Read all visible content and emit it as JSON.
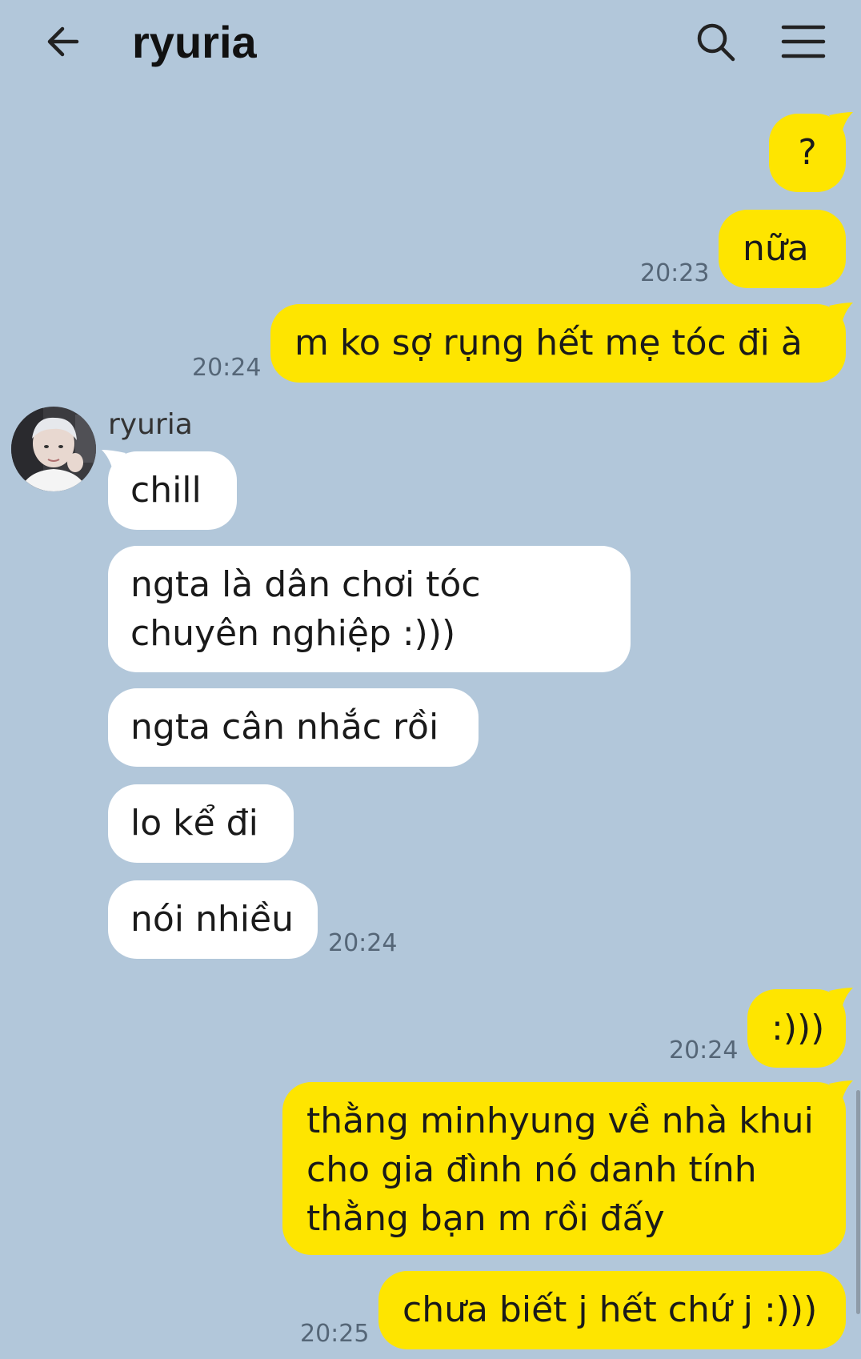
{
  "header": {
    "title": "ryuria",
    "back_icon": "arrow-left-icon",
    "search_icon": "search-icon",
    "menu_icon": "hamburger-menu-icon"
  },
  "colors": {
    "background": "#b2c7da",
    "my_bubble": "#fee500",
    "their_bubble": "#ffffff",
    "time_text": "#556677"
  },
  "messages": {
    "m1": "?",
    "m2": "nữa",
    "m2_time": "20:23",
    "m3": "m ko sợ rụng hết mẹ tóc đi à",
    "m3_time": "20:24",
    "sender": "ryuria",
    "t1": "chill",
    "t2": "ngta là dân chơi tóc chuyên nghiệp :)))",
    "t3": "ngta cân nhắc rồi",
    "t4": "lo kể đi",
    "t5": "nói nhiều",
    "t5_time": "20:24",
    "m4": ":)))",
    "m4_time": "20:24",
    "m5": "thằng minhyung về nhà khui cho gia đình nó danh tính thằng bạn m rồi đấy",
    "m6": "chưa biết j hết chứ j :)))",
    "m6_time": "20:25"
  }
}
